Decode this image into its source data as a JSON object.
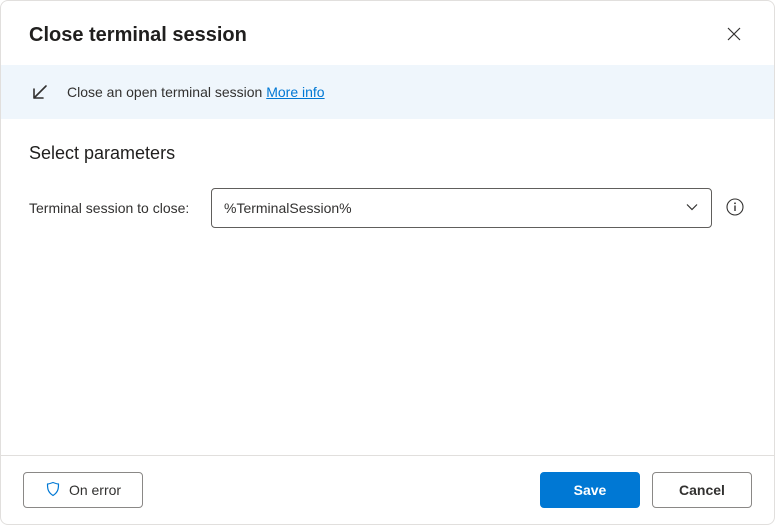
{
  "dialog": {
    "title": "Close terminal session"
  },
  "banner": {
    "text": "Close an open terminal session ",
    "link": "More info"
  },
  "params": {
    "section_title": "Select parameters",
    "session_label": "Terminal session to close:",
    "session_value": "%TerminalSession%"
  },
  "footer": {
    "on_error": "On error",
    "save": "Save",
    "cancel": "Cancel"
  }
}
